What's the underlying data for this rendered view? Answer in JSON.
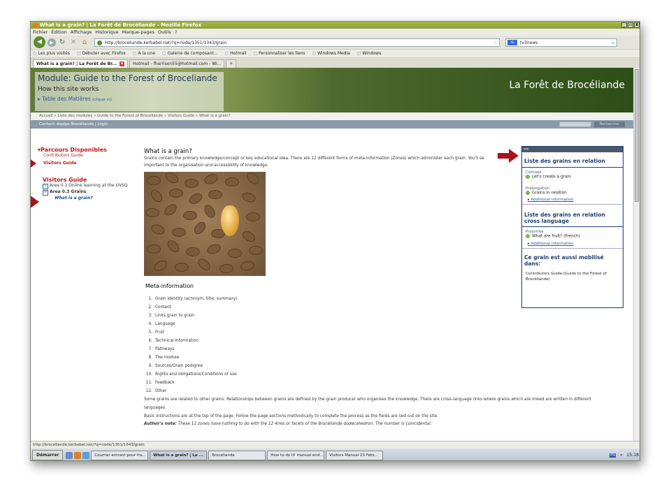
{
  "window": {
    "title": "What is a grain? | La Forêt de Brocéliande - Mozilla Firefox",
    "controls": [
      "_",
      "▫",
      "x"
    ]
  },
  "menu": [
    "Fichier",
    "Édition",
    "Affichage",
    "Historique",
    "Marque-pages",
    "Outils",
    "?"
  ],
  "nav": {
    "url": "http://broceliande.kerbabel.net/?q=node/1351/1343/grain",
    "search_value": "tv3news",
    "search_engine": "G"
  },
  "bookmarks": [
    "Les plus visités",
    "Débuter avec Firefox",
    "À la une",
    "Galerie de composant...",
    "Hotmail",
    "Personnaliser les liens",
    "Windows Media",
    "Windows"
  ],
  "tabs": [
    {
      "label": "What is a grain? | La Forêt de Br..."
    },
    {
      "label": "Hotmail - fharrison55@hotmail.com - Wi..."
    },
    {
      "label": "+"
    }
  ],
  "banner": {
    "module": "Module: Guide to the Forest of Broceliande",
    "how": "How this site works",
    "toc": "Table des Matières",
    "toc_hint": "(cliquer ici)",
    "site": "La Forêt de Brocéliande"
  },
  "breadcrumb": "Accueil » Liste des modules » Guide to the Forest of Broceliande » Visitors Guide » What is a grain?",
  "loginbar": {
    "text": "Contact: équipe Brocéliande  |  Login",
    "search_button": "Rechercher"
  },
  "leftnav": {
    "heading": "Parcours Disponibles",
    "contributors": "Contributors Guide",
    "visitors": "Visitors Guide",
    "vguide_heading": "Visitors Guide",
    "areas": [
      "Area 0.1 Online learning at the UVSQ",
      "Area 0.3 Grains"
    ],
    "current": "What is a grain?"
  },
  "main": {
    "heading": "What is a grain?",
    "intro": "Grains contain the primary knowledge/concept or key educational idea. There are 12 different forms of meta-information (Zones) which administer each grain. You'll se",
    "intro2": "important to the organisation and accessibility of knowledge.",
    "meta_heading": "Meta-information",
    "list": [
      "Grain identity (acronym, title, summary)",
      "Content",
      "Links grain to grain",
      "Language",
      "Fruit",
      "Technical Information",
      "Pathways",
      "The module",
      "Sources/Grain pedigree",
      "Rights and obligations/Conditions of use",
      "Feedback",
      "Other"
    ],
    "para1": "Some grains are related to other grains. Relationships between grains are defined by the grain producer who organises the knowledge. There are cross-language links where grains which are linked are written in different",
    "para1b": "languages.",
    "para2": "Basic instructions are at the top of the page. Follow the page sections methodically to complete the process as the fields are laid out on the site.",
    "author_label": "Author's note:",
    "author_text": " These 12 zones have nothing to do with the 12 4ires or facets of the Brocéliande dodecahedron. The number is coincidental."
  },
  "rpanel": {
    "top": "»»",
    "h1": "Liste des grains en relation",
    "cat1": "Concept",
    "item1": "Let's create a grain",
    "cat2": "Prolongation",
    "item2": "Grains in relation",
    "link1": "Additional information",
    "h2": "Liste des grains en relation cross language",
    "cat3": "Proximite",
    "item3": "What are fruit? (French)",
    "link2": "Additional information",
    "h3": "Ce grain est aussi mobilisé dans:",
    "text3": "Contributors Guide (Guide to the Forest of Brocéliande)"
  },
  "status": "http://broceliande.kerbabel.net/?q=node/1351/1343/grain",
  "taskbar": {
    "start": "Démarrer",
    "buttons": [
      "Courrier entrant pour fra...",
      "What is a grain? | La ...",
      "Broceliande",
      "How to do it! manual end...",
      "Visitors Manual 23 Febr..."
    ],
    "lang": "EN",
    "clock": "15:18"
  },
  "colors": {
    "accent_red": "#c01818",
    "nav_blue": "#1d4070",
    "title_green": "#8ea034"
  }
}
